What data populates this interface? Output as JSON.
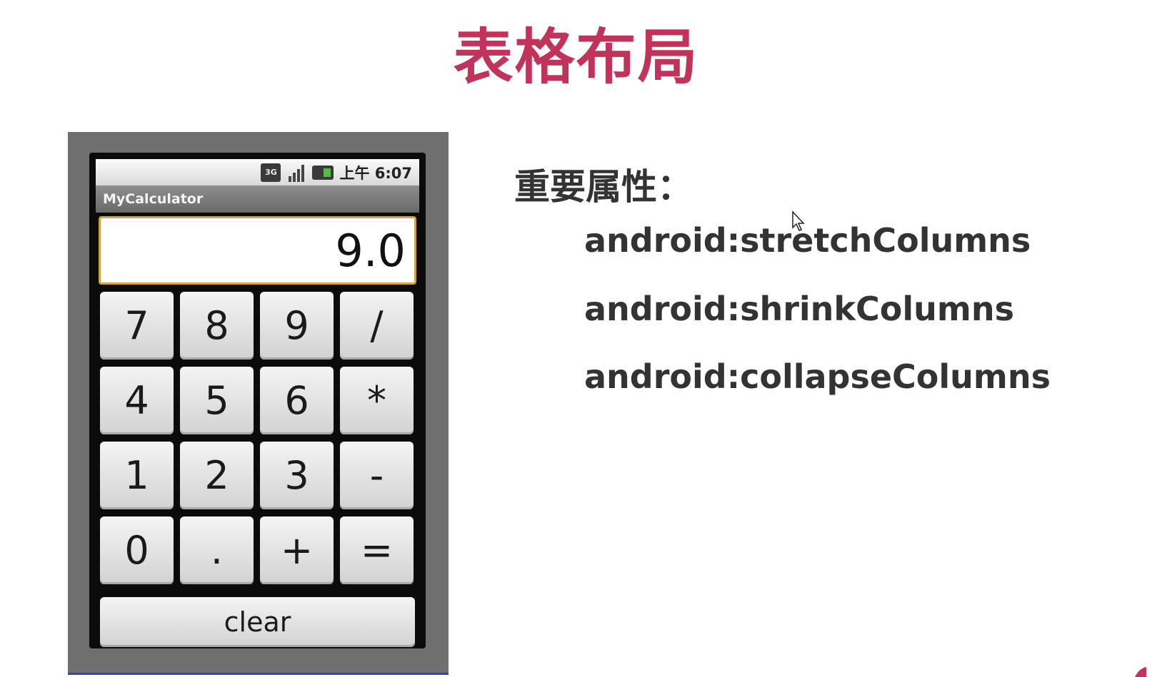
{
  "colors": {
    "title": "#c1335a",
    "text": "#333333",
    "display_border": "#d4a23a",
    "phone_frame": "#6f6f6f"
  },
  "slide": {
    "title": "表格布局",
    "heading": "重要属性：",
    "properties": [
      "android:stretchColumns",
      "android:shrinkColumns",
      "android:collapseColumns"
    ]
  },
  "phone": {
    "status_bar": {
      "network_label": "3G",
      "icons": [
        "network-3g-icon",
        "signal-icon",
        "battery-icon"
      ],
      "time": "上午 6:07"
    },
    "app_title": "MyCalculator",
    "display_value": "9.0",
    "keys": [
      "7",
      "8",
      "9",
      "/",
      "4",
      "5",
      "6",
      "*",
      "1",
      "2",
      "3",
      "-",
      "0",
      ".",
      "+",
      "="
    ],
    "clear_label": "clear"
  }
}
